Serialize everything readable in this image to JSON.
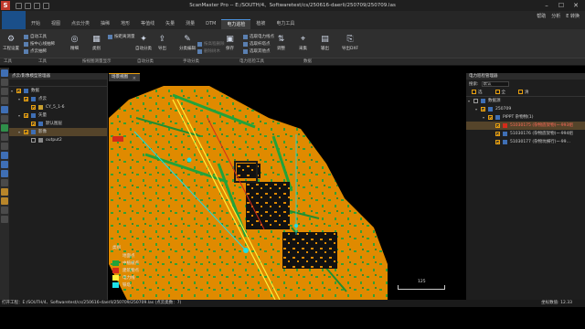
{
  "app": {
    "title": "ScanMaster Pro -- E:/SOUTH/4、Softwaretest/cs/250616-daerli/250709/250709.las",
    "logo_letter": "S",
    "window_controls": [
      "–",
      "☐",
      "✕"
    ]
  },
  "menu": {
    "tabs": [
      "开始",
      "视图",
      "点云分类",
      "抽稀",
      "地形",
      "等值线",
      "矢量",
      "测量",
      "DTM",
      "电力巡检",
      "植被",
      "电力工具"
    ],
    "active_index": 9,
    "right_items": [
      "帮助",
      "分析",
      "E 转换"
    ]
  },
  "ribbon": {
    "buttons": [
      {
        "label": "工程设置",
        "icon": "gear-icon",
        "glyph": "⚙"
      },
      {
        "label": "精细",
        "icon": "refine-icon",
        "glyph": "◎"
      },
      {
        "label": "类别",
        "icon": "class-icon",
        "glyph": "▦"
      },
      {
        "label": "自动分类",
        "icon": "auto-class-icon",
        "glyph": "✦"
      },
      {
        "label": "导出",
        "icon": "export-icon",
        "glyph": "⇪"
      },
      {
        "label": "分类编辑",
        "icon": "edit-icon",
        "glyph": "✎"
      },
      {
        "label": "保存",
        "icon": "save-icon",
        "glyph": "▣"
      },
      {
        "label": "调整",
        "icon": "adjust-icon",
        "glyph": "⇅"
      },
      {
        "label": "采集",
        "icon": "collect-icon",
        "glyph": "⌖"
      },
      {
        "label": "输出",
        "icon": "output-icon",
        "glyph": "▤"
      },
      {
        "label": "导出DXF",
        "icon": "dxf-icon",
        "glyph": "⎘"
      }
    ],
    "small": [
      {
        "label": "自动工具",
        "dim": false
      },
      {
        "label": "按中心线抽稀",
        "dim": false
      },
      {
        "label": "点云抽稀",
        "dim": false
      },
      {
        "label": "按距离测量",
        "dim": false
      },
      {
        "label": "按高程删除",
        "dim": true
      },
      {
        "label": "删除树木",
        "dim": true
      },
      {
        "label": "选取电力线点",
        "dim": false
      },
      {
        "label": "选取杆塔点",
        "dim": false
      },
      {
        "label": "选取其他点",
        "dim": false
      }
    ],
    "groups": [
      "工具",
      "工具",
      "按视图测量显示",
      "自动分类",
      "手动分类",
      "电力巡检工具",
      "数据"
    ]
  },
  "left_panel": {
    "title": "点云/影像模型管理器",
    "tree": [
      {
        "label": "数据",
        "level": 0,
        "checked": true,
        "expand": "▾",
        "icon_color": "#3f6fb5",
        "selected": false
      },
      {
        "label": "点云",
        "level": 1,
        "checked": true,
        "expand": "▾",
        "icon_color": "#3f6fb5",
        "selected": false
      },
      {
        "label": "CY_5_1-6",
        "level": 2,
        "checked": true,
        "expand": "",
        "icon_color": "#c8a030",
        "selected": false
      },
      {
        "label": "矢量",
        "level": 1,
        "checked": true,
        "expand": "▾",
        "icon_color": "#3f6fb5",
        "selected": false
      },
      {
        "label": "默认图层",
        "level": 2,
        "checked": true,
        "expand": "",
        "icon_color": "#3f6fb5",
        "selected": false
      },
      {
        "label": "影像",
        "level": 1,
        "checked": true,
        "expand": "▾",
        "icon_color": "#3f6fb5",
        "selected": true
      },
      {
        "label": "output2",
        "level": 2,
        "checked": false,
        "expand": "",
        "icon_color": "#888888",
        "selected": false
      }
    ]
  },
  "viewer": {
    "tab_label": "场景视图",
    "legend_title": "类别",
    "legend": [
      {
        "label": "地面点",
        "color": "#e08a00"
      },
      {
        "label": "中植被点",
        "color": "#22a33a"
      },
      {
        "label": "建筑物点",
        "color": "#d42b1a"
      },
      {
        "label": "电力线",
        "color": "#ffef3a"
      },
      {
        "label": "铁塔",
        "color": "#1de0e8"
      }
    ],
    "scale_label": "125"
  },
  "right_panel": {
    "title": "电力巡检管理器",
    "search_label": "搜索:",
    "search_value": "默认",
    "toolbar": [
      "选",
      "全",
      "清"
    ],
    "tree": [
      {
        "label": "数据源",
        "level": 0,
        "checked": false,
        "expand": "▾",
        "icon_color": "#3f6fb5",
        "selected": false
      },
      {
        "label": "250709",
        "level": 1,
        "checked": true,
        "expand": "▾",
        "icon_color": "#3f6fb5",
        "selected": false
      },
      {
        "label": "PIPPT 杂物物(1)",
        "level": 2,
        "checked": true,
        "expand": "▾",
        "icon_color": "#3f6fb5",
        "selected": false
      },
      {
        "label": "51030175 (杂物底架物)~-993组",
        "level": 3,
        "checked": true,
        "expand": "",
        "icon_color": "#d42b1a",
        "selected": true
      },
      {
        "label": "51030176 (杂物底架物)~-994组",
        "level": 3,
        "checked": true,
        "expand": "",
        "icon_color": "#3f6fb5",
        "selected": false
      },
      {
        "label": "51030177 (杂物坑横行)~-99…",
        "level": 3,
        "checked": true,
        "expand": "",
        "icon_color": "#3f6fb5",
        "selected": false
      }
    ]
  },
  "status": {
    "left": "打开工程：E:/SOUTH/4、Softwaretest/cs/250616-daerli/250709/250709.las (点云类数：7)",
    "right": "坐标数值: 12.33"
  },
  "colors": {
    "ground": "#e08a00",
    "vegetation": "#22a33a",
    "building": "#d42b1a",
    "powerline": "#ffef3a",
    "tower": "#1de0e8",
    "accent": "#e8a010"
  }
}
